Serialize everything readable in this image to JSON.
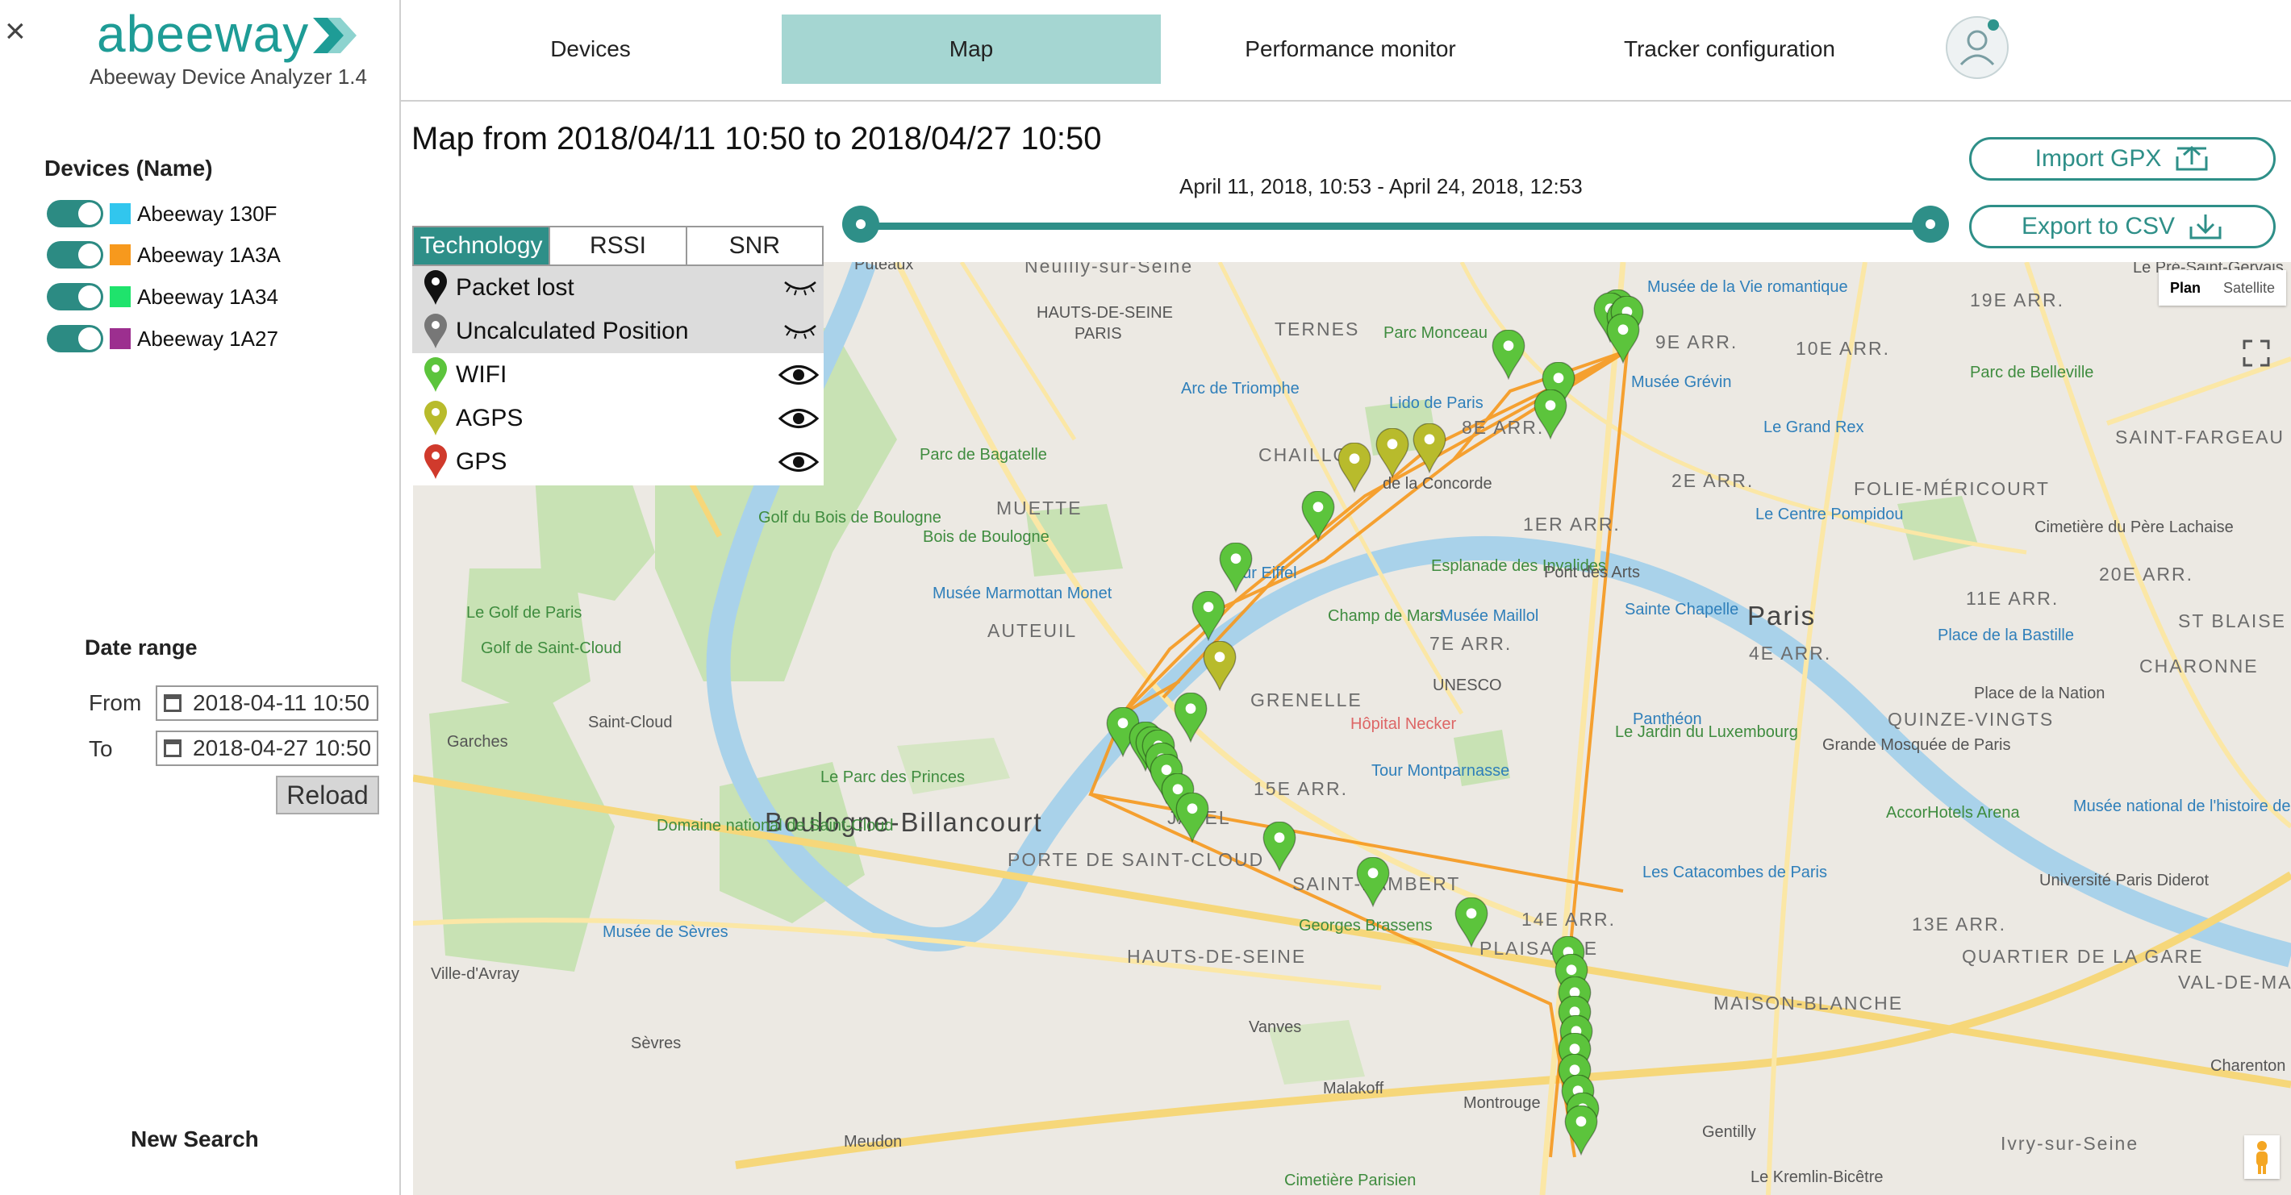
{
  "app": {
    "logo_text": "abeeway",
    "version": "Abeeway Device Analyzer 1.4",
    "close_icon": "×"
  },
  "sidebar": {
    "devices_title": "Devices (Name)",
    "devices": [
      {
        "name": "Abeeway 130F",
        "color": "#31c6ee",
        "enabled": true
      },
      {
        "name": "Abeeway 1A3A",
        "color": "#f7991d",
        "enabled": true
      },
      {
        "name": "Abeeway 1A34",
        "color": "#1fe36c",
        "enabled": true
      },
      {
        "name": "Abeeway 1A27",
        "color": "#9c2f8f",
        "enabled": true
      }
    ],
    "date_range_title": "Date range",
    "from_label": "From",
    "from_value": "2018-04-11 10:50",
    "to_label": "To",
    "to_value": "2018-04-27 10:50",
    "reload_label": "Reload",
    "new_search_label": "New Search"
  },
  "nav": {
    "tabs": [
      {
        "label": "Devices",
        "active": false
      },
      {
        "label": "Map",
        "active": true
      },
      {
        "label": "Performance monitor",
        "active": false
      },
      {
        "label": "Tracker configuration",
        "active": false
      }
    ],
    "avatar_icon": "user-avatar-icon"
  },
  "map_header": {
    "title": "Map from 2018/04/11 10:50 to 2018/04/27 10:50",
    "range_label": "April 11, 2018, 10:53 - April 24, 2018, 12:53",
    "import_label": "Import GPX",
    "export_label": "Export to CSV",
    "slider": {
      "start_fraction": 0.0,
      "end_fraction": 1.0
    }
  },
  "legend": {
    "tabs": [
      {
        "label": "Technology",
        "active": true
      },
      {
        "label": "RSSI",
        "active": false
      },
      {
        "label": "SNR",
        "active": false
      }
    ],
    "items": [
      {
        "label": "Packet lost",
        "color": "#111111",
        "visible": false
      },
      {
        "label": "Uncalculated Position",
        "color": "#777777",
        "visible": false
      },
      {
        "label": "WIFI",
        "color": "#5cc43c",
        "visible": true
      },
      {
        "label": "AGPS",
        "color": "#b8bb2c",
        "visible": true
      },
      {
        "label": "GPS",
        "color": "#d03a2c",
        "visible": true
      }
    ]
  },
  "map": {
    "map_type_buttons": [
      {
        "label": "Plan",
        "active": true
      },
      {
        "label": "Satellite",
        "active": false
      }
    ],
    "labels": [
      "Puteaux",
      "Neuilly-sur-Seine",
      "HAUTS-DE-SEINE",
      "PARIS",
      "TERNES",
      "Parc Monceau",
      "Musée de la Vie romantique",
      "9E ARR.",
      "10E ARR.",
      "19E ARR.",
      "Le Pré-Saint-Gervais",
      "Arc de Triomphe",
      "Lido de Paris",
      "8E ARR.",
      "Musée Grévin",
      "Parc de Belleville",
      "Le Grand Rex",
      "SAINT-FARGEAU",
      "CHAILLOT",
      "2E ARR.",
      "FOLIE-MÉRICOURT",
      "Parc de Bagatelle",
      "MUETTE",
      "de la Concorde",
      "1ER ARR.",
      "Le Centre Pompidou",
      "Cimetière du Père Lachaise",
      "Golf du Bois de Boulogne",
      "Bois de Boulogne",
      "Tour Eiffel",
      "Esplanade des Invalides",
      "Pont des Arts",
      "20E ARR.",
      "Musée Marmottan Monet",
      "Champ de Mars",
      "Musée Maillol",
      "Sainte Chapelle",
      "Paris",
      "11E ARR.",
      "Le Golf de Paris",
      "AUTEUIL",
      "7E ARR.",
      "4E ARR.",
      "Place de la Bastille",
      "ST BLAISE",
      "Golf de Saint-Cloud",
      "UNESCO",
      "GRENELLE",
      "CHARONNE",
      "Hôpital Necker",
      "Panthéon",
      "Place de la Nation",
      "QUINZE-VINGTS",
      "Saint-Cloud",
      "Garches",
      "Le Jardin du Luxembourg",
      "Le Parc des Princes",
      "Tour Montparnasse",
      "Grande Mosquée de Paris",
      "15E ARR.",
      "Boulogne-Billancourt",
      "JAVEL",
      "AccorHotels Arena",
      "Musée national de l'histoire de l'immigration",
      "Domaine national de Saint-Cloud",
      "PORTE DE SAINT-CLOUD",
      "Les Catacombes de Paris",
      "SAINT-LAMBERT",
      "Université Paris Diderot",
      "Georges Brassens",
      "14E ARR.",
      "13E ARR.",
      "Musée de Sèvres",
      "PLAISANCE",
      "QUARTIER DE LA GARE",
      "Ville-d'Avray",
      "HAUTS-DE-SEINE",
      "MAISON-BLANCHE",
      "VAL-DE-MARNE",
      "Vanves",
      "Sèvres",
      "Malakoff",
      "Montrouge",
      "Gentilly",
      "Ivry-sur-Seine",
      "Charenton",
      "Meudon",
      "Cimetière Parisien",
      "Le Kremlin-Bicêtre"
    ]
  }
}
